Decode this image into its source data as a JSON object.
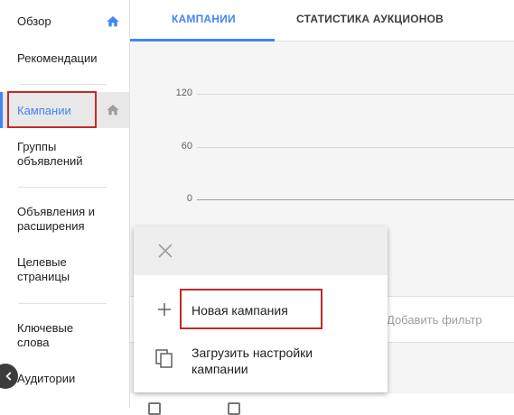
{
  "sidebar": {
    "items": [
      {
        "label": "Обзор"
      },
      {
        "label": "Рекомендации"
      },
      {
        "label": "Кампании"
      },
      {
        "label": "Группы объявлений"
      },
      {
        "label": "Объявления и расширения"
      },
      {
        "label": "Целевые страницы"
      },
      {
        "label": "Ключевые слова"
      },
      {
        "label": "Аудитории"
      }
    ],
    "active_item": "Кампании",
    "accent_color": "#4285f4",
    "highlight_color": "#c62828",
    "collapse_icon": "chevron-left-icon"
  },
  "tabs": [
    {
      "label": "КАМПАНИИ",
      "active": true
    },
    {
      "label": "СТАТИСТИКА АУКЦИОНОВ",
      "active": false
    }
  ],
  "chart": {
    "y_ticks": [
      "120",
      "60",
      "0"
    ]
  },
  "filter": {
    "placeholder": "Добавить фильтр"
  },
  "popup": {
    "close_icon": "close-icon",
    "items": [
      {
        "icon": "plus-icon",
        "label": "Новая кампания",
        "highlighted": true
      },
      {
        "icon": "copy-icon",
        "label": "Загрузить настройки кампании",
        "highlighted": false
      }
    ]
  }
}
